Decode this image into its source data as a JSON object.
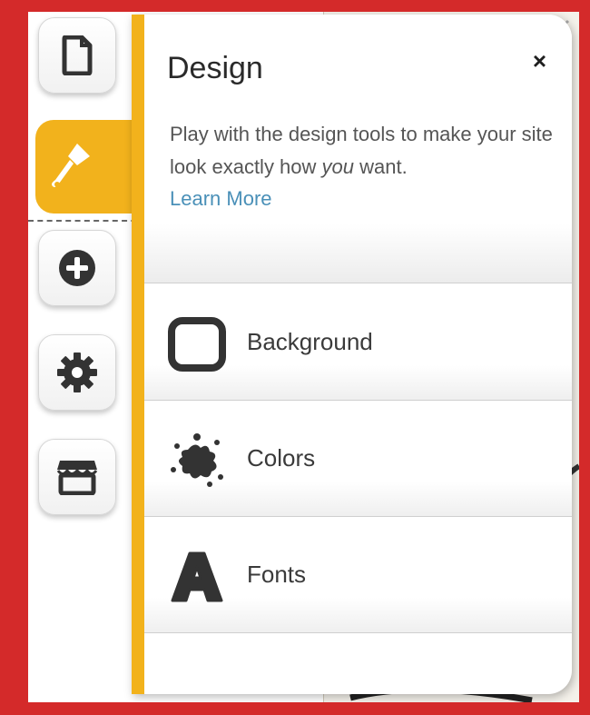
{
  "panel": {
    "title": "Design",
    "close_label": "×",
    "description_before": "Play with the design tools to make your site look exactly how ",
    "description_emphasis": "you",
    "description_after": " want.",
    "learn_more": "Learn More"
  },
  "items": [
    {
      "label": "Background",
      "icon": "rounded-square-icon"
    },
    {
      "label": "Colors",
      "icon": "paint-splat-icon"
    },
    {
      "label": "Fonts",
      "icon": "letter-a-icon"
    }
  ],
  "rail": [
    {
      "icon": "page-icon"
    },
    {
      "icon": "paintbrush-icon",
      "active": true
    },
    {
      "icon": "add-circle-icon"
    },
    {
      "icon": "gear-icon"
    },
    {
      "icon": "store-icon"
    }
  ],
  "colors": {
    "accent": "#f2b21c",
    "frame": "#d42a2a",
    "link": "#4a90b8"
  }
}
